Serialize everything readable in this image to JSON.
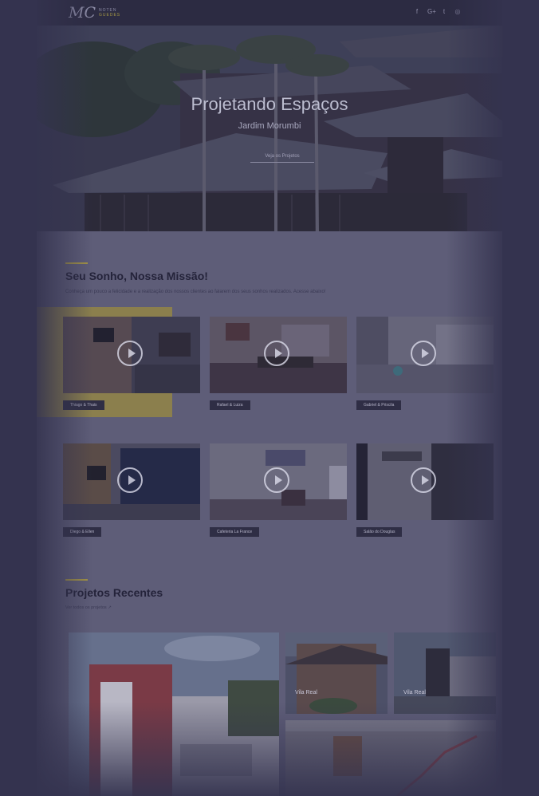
{
  "header": {
    "logo_mark": "MC",
    "logo_line1": "NOTEN",
    "logo_line2": "GUEDES",
    "social_icons": [
      "facebook-icon",
      "google-plus-icon",
      "twitter-icon",
      "instagram-icon"
    ],
    "social_glyphs": [
      "f",
      "G+",
      "t",
      "◎"
    ]
  },
  "hero": {
    "title": "Projetando Espaços",
    "subtitle": "Jardim Morumbi",
    "button_label": "Veja os Projetos"
  },
  "mission": {
    "title": "Seu Sonho, Nossa Missão!",
    "description": "Conheça um pouco a felicidade e a realização dos nossos clientes ao falarem dos seus sonhos realizados. Acesse abaixo!",
    "videos": [
      {
        "label": "Thiago & Thais",
        "scene": "living-tv"
      },
      {
        "label": "Rafael & Luiza",
        "scene": "living-painting"
      },
      {
        "label": "Gabriel & Priscila",
        "scene": "kitchen-stairs"
      },
      {
        "label": "Diego & Ellen",
        "scene": "room-board"
      },
      {
        "label": "Cafeteria La France",
        "scene": "cafe"
      },
      {
        "label": "Salão do Douglas",
        "scene": "salon"
      }
    ]
  },
  "recent": {
    "title": "Projetos Recentes",
    "link_label": "Ver todos os projetos",
    "projects": [
      {
        "name": ""
      },
      {
        "name": "Vila Real"
      },
      {
        "name": "Vila Real"
      },
      {
        "name": ""
      }
    ]
  },
  "colors": {
    "accent": "#a59545",
    "overlay": "#34334f",
    "label_bg": "#2f2e45"
  }
}
